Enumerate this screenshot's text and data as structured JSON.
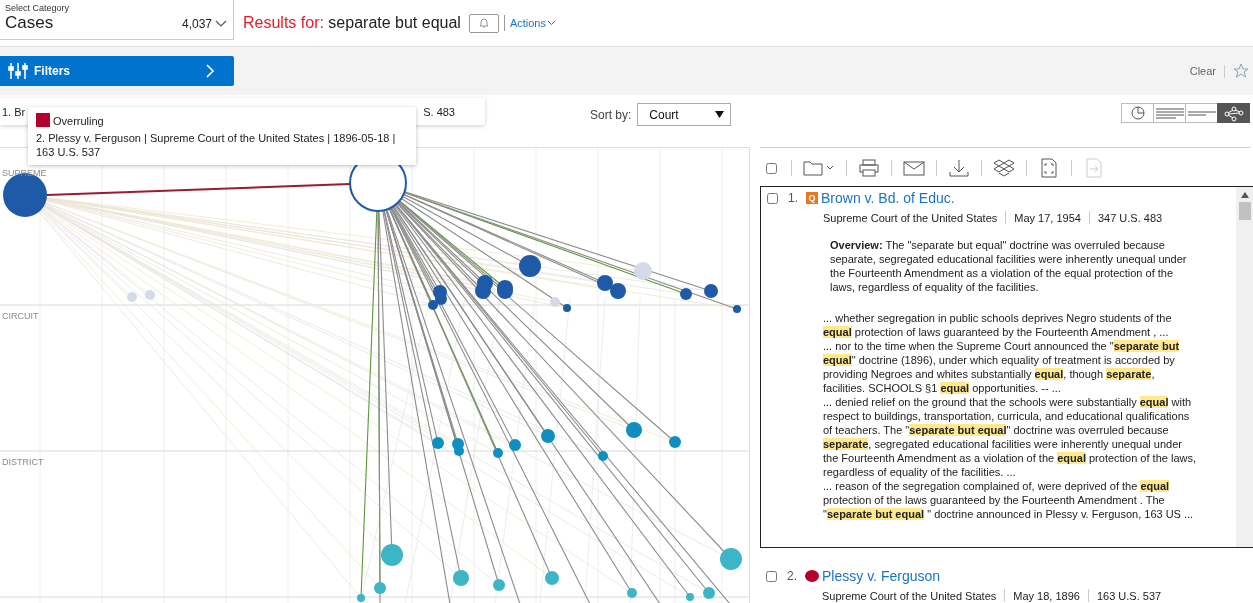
{
  "category": {
    "label": "Select Category",
    "value": "Cases",
    "count": "4,037"
  },
  "results": {
    "prefix": "Results for:",
    "query": "separate but equal"
  },
  "actions": {
    "label": "Actions"
  },
  "filters": {
    "label": "Filters"
  },
  "clear": {
    "label": "Clear"
  },
  "hover_bar": {
    "left": "1. Br",
    "right": "S. 483"
  },
  "tooltip": {
    "label": "Overruling",
    "color": "#b5002e",
    "text": "2. Plessy v. Ferguson | Supreme Court of the United States | 1896-05-18 | 163 U.S. 537"
  },
  "sort": {
    "label": "Sort by:",
    "value": "Court"
  },
  "views": [
    {
      "kind": "pie",
      "selected": false
    },
    {
      "kind": "list",
      "selected": false
    },
    {
      "kind": "brief",
      "selected": false
    },
    {
      "kind": "graph",
      "selected": true
    }
  ],
  "chart": {
    "lanes": [
      "SUPREME",
      "CIRCUIT",
      "DISTRICT"
    ]
  },
  "select_all": {
    "checked": false
  },
  "toolbar": [
    {
      "kind": "folder",
      "disabled": false
    },
    {
      "kind": "print",
      "disabled": false
    },
    {
      "kind": "mail",
      "disabled": false
    },
    {
      "kind": "download",
      "disabled": false
    },
    {
      "kind": "dropbox",
      "disabled": false
    },
    {
      "kind": "expand",
      "disabled": false
    },
    {
      "kind": "export",
      "disabled": true
    }
  ],
  "results_list": [
    {
      "number": "1.",
      "checked": false,
      "flag": {
        "kind": "caution",
        "color": "#e8761e",
        "text": "Q"
      },
      "title": "Brown v. Bd. of Educ.",
      "court": "Supreme Court of the United States",
      "date": "May 17, 1954",
      "citation": "347 U.S. 483",
      "overview": "**Overview:**  The \"separate but equal\" doctrine was overruled because separate, segregated educational facilities were inherently unequal under the Fourteenth Amendment as a violation of the equal protection of the laws, regardless of equality of the facilities.",
      "snippets": [
        "... whether segregation in public schools deprives Negro students of the **equal** protection of laws guaranteed by the Fourteenth Amendment , ...",
        "... nor to the time when the Supreme Court announced the \"**separate but equal**\" doctrine (1896), under which equality of treatment is accorded by providing Negroes and whites substantially **equal**, though **separate**, facilities. SCHOOLS §1 **equal** opportunities. -- ...",
        "... denied relief on the ground that the schools were substantially **equal** with respect to buildings, transportation, curricula, and educational qualifications of teachers. The \"**separate but equal**\" doctrine was overruled because **separate**, segregated educational facilities were inherently unequal under the Fourteenth Amendment as a violation of the **equal** protection of the laws, regardless of equality of the facilities. ...",
        "... reason of the segregation complained of, were deprived of the **equal** protection of the laws guaranteed by the Fourteenth Amendment . The \"**separate but equal** \" doctrine announced in Plessy v. Ferguson, 163 US ..."
      ]
    },
    {
      "number": "2.",
      "checked": false,
      "flag": {
        "kind": "negative",
        "color": "#b5002e"
      },
      "title": "Plessy v. Ferguson",
      "court": "Supreme Court of the United States",
      "date": "May 18, 1896",
      "citation": "163 U.S. 537"
    }
  ]
}
